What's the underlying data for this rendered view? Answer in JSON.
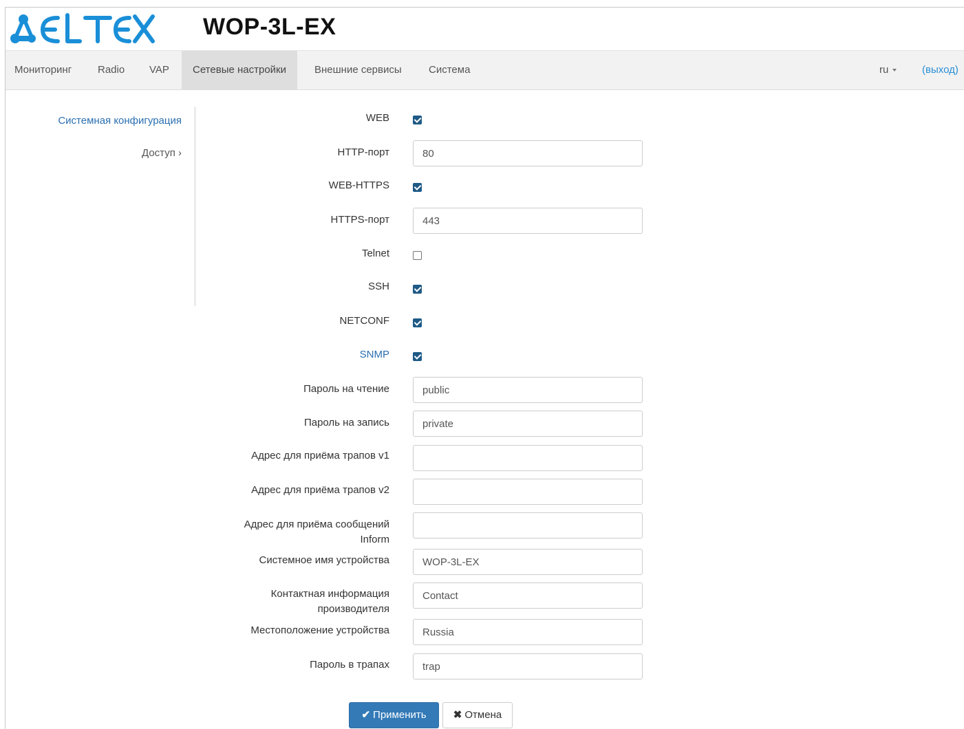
{
  "brand": {
    "logo_text": "ELTEX",
    "logo_color": "#1a8fd8"
  },
  "header": {
    "device_title": "WOP-3L-EX"
  },
  "nav": {
    "items": [
      {
        "label": "Мониторинг"
      },
      {
        "label": "Radio"
      },
      {
        "label": "VAP"
      },
      {
        "label": "Сетевые настройки",
        "active": true
      },
      {
        "label": "Внешние сервисы"
      },
      {
        "label": "Система"
      }
    ],
    "lang": "ru",
    "logout": "(выход)"
  },
  "sidebar": {
    "items": [
      {
        "label": "Системная конфигурация"
      },
      {
        "label": "Доступ ›"
      }
    ]
  },
  "form": {
    "web": {
      "label": "WEB",
      "checked": true
    },
    "http_port": {
      "label": "HTTP-порт",
      "value": "80"
    },
    "web_https": {
      "label": "WEB-HTTPS",
      "checked": true
    },
    "https_port": {
      "label": "HTTPS-порт",
      "value": "443"
    },
    "telnet": {
      "label": "Telnet",
      "checked": false
    },
    "ssh": {
      "label": "SSH",
      "checked": true
    },
    "netconf": {
      "label": "NETCONF",
      "checked": true
    },
    "snmp": {
      "label": "SNMP",
      "checked": true
    },
    "read_password": {
      "label": "Пароль на чтение",
      "value": "public"
    },
    "write_password": {
      "label": "Пароль на запись",
      "value": "private"
    },
    "trap_v1": {
      "label": "Адрес для приёма трапов v1",
      "value": ""
    },
    "trap_v2": {
      "label": "Адрес для приёма трапов v2",
      "value": ""
    },
    "inform": {
      "label": "Адрес для приёма сообщений Inform",
      "value": ""
    },
    "sys_name": {
      "label": "Системное имя устройства",
      "value": "WOP-3L-EX"
    },
    "contact": {
      "label": "Контактная информация производителя",
      "value": "Contact"
    },
    "location": {
      "label": "Местоположение устройства",
      "value": "Russia"
    },
    "trap_password": {
      "label": "Пароль в трапах",
      "value": "trap"
    }
  },
  "buttons": {
    "apply": {
      "icon": "check-icon",
      "label": "Применить"
    },
    "cancel": {
      "icon": "times-icon",
      "label": "Отмена"
    }
  },
  "colors": {
    "link": "#2a6fb0",
    "primary_button": "#337ab7",
    "checkbox": "#1f5a86"
  }
}
